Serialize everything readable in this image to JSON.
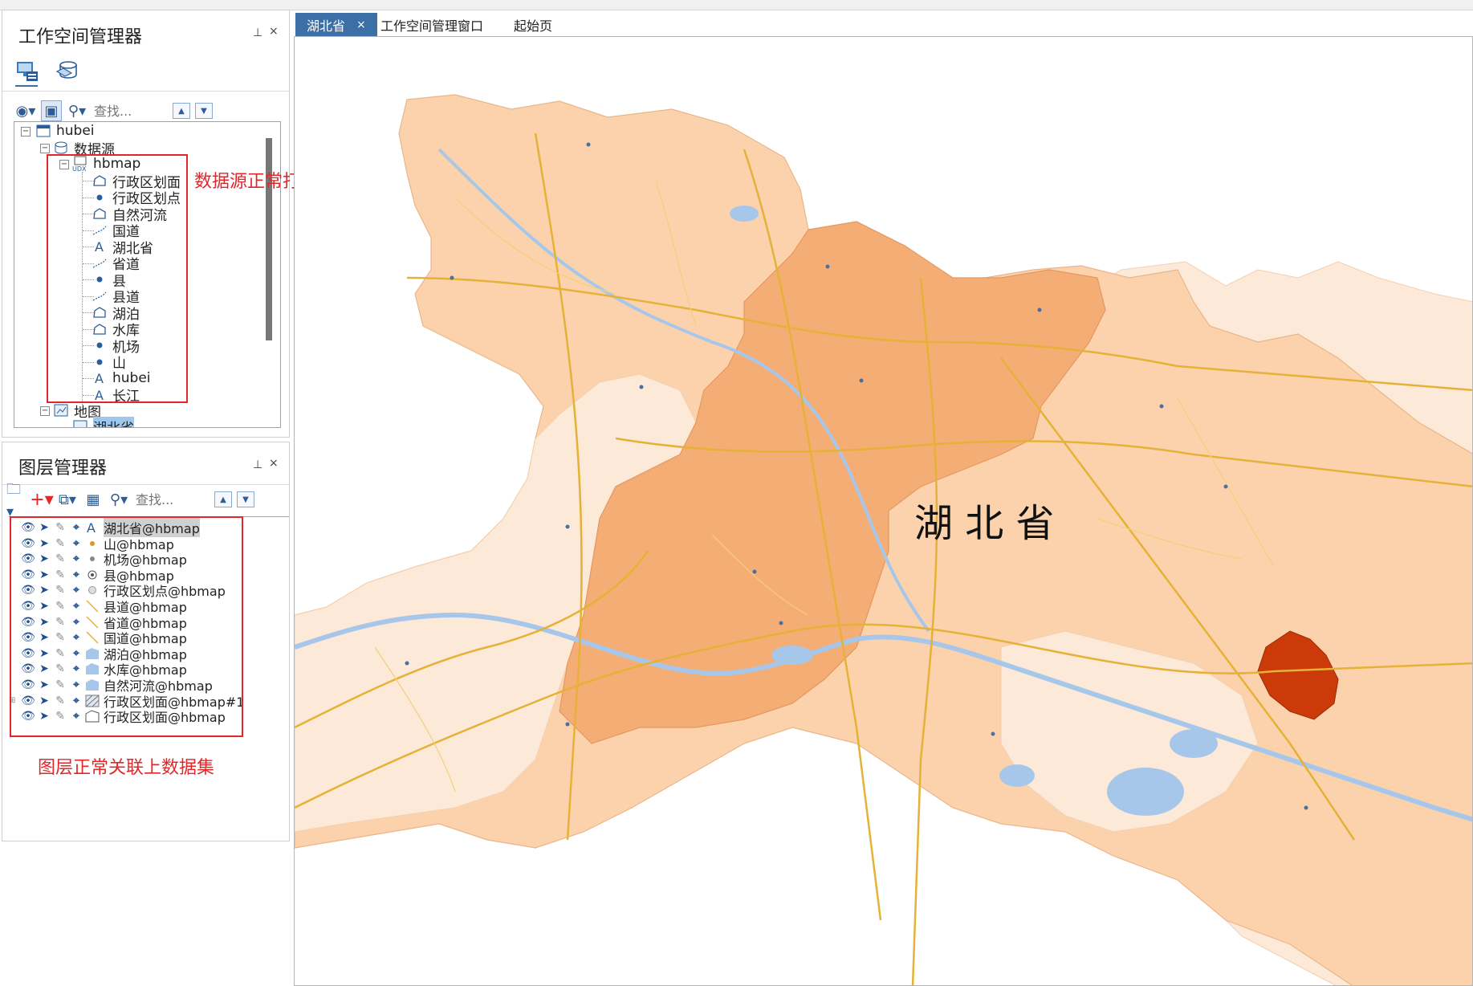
{
  "workspace_panel": {
    "title": "工作空间管理器",
    "pin_icon": "pin-icon",
    "close_label": "×",
    "search_placeholder": "查找...",
    "tree": {
      "root": "hubei",
      "datasources_label": "数据源",
      "datasource": "hbmap",
      "datasets": [
        {
          "name": "行政区划面",
          "icon": "region"
        },
        {
          "name": "行政区划点",
          "icon": "point"
        },
        {
          "name": "自然河流",
          "icon": "region"
        },
        {
          "name": "国道",
          "icon": "line"
        },
        {
          "name": "湖北省",
          "icon": "text"
        },
        {
          "name": "省道",
          "icon": "line"
        },
        {
          "name": "县",
          "icon": "point"
        },
        {
          "name": "县道",
          "icon": "line"
        },
        {
          "name": "湖泊",
          "icon": "region"
        },
        {
          "name": "水库",
          "icon": "region"
        },
        {
          "name": "机场",
          "icon": "point"
        },
        {
          "name": "山",
          "icon": "point"
        },
        {
          "name": "hubei",
          "icon": "text"
        },
        {
          "name": "长江",
          "icon": "text"
        }
      ],
      "maps_label": "地图",
      "map_item": "湖北省"
    },
    "annotation": "数据源正常打开"
  },
  "layer_panel": {
    "title": "图层管理器",
    "close_label": "×",
    "search_placeholder": "查找...",
    "layers": [
      {
        "name": "湖北省@hbmap",
        "icon": "text",
        "highlight": true
      },
      {
        "name": "山@hbmap",
        "icon": "dot-orange"
      },
      {
        "name": "机场@hbmap",
        "icon": "dot-gray"
      },
      {
        "name": "县@hbmap",
        "icon": "dot-ring"
      },
      {
        "name": "行政区划点@hbmap",
        "icon": "dot-light"
      },
      {
        "name": "县道@hbmap",
        "icon": "line"
      },
      {
        "name": "省道@hbmap",
        "icon": "line"
      },
      {
        "name": "国道@hbmap",
        "icon": "line"
      },
      {
        "name": "湖泊@hbmap",
        "icon": "region-blue"
      },
      {
        "name": "水库@hbmap",
        "icon": "region-blue"
      },
      {
        "name": "自然河流@hbmap",
        "icon": "region-blue"
      },
      {
        "name": "行政区划面@hbmap#1",
        "icon": "region-hatch"
      },
      {
        "name": "行政区划面@hbmap",
        "icon": "region-outline"
      }
    ],
    "annotation": "图层正常关联上数据集"
  },
  "tabs": [
    {
      "label": "湖北省",
      "active": true,
      "close": "×"
    },
    {
      "label": "工作空间管理窗口",
      "active": false
    },
    {
      "label": "起始页",
      "active": false
    }
  ],
  "map": {
    "label": "湖 北 省",
    "colors": {
      "light": "#fde9d8",
      "mid": "#fbd2ac",
      "dark": "#f5ad76",
      "highlight": "#cc3a0a",
      "water": "#a7c7ea",
      "road": "#e5b136"
    }
  }
}
